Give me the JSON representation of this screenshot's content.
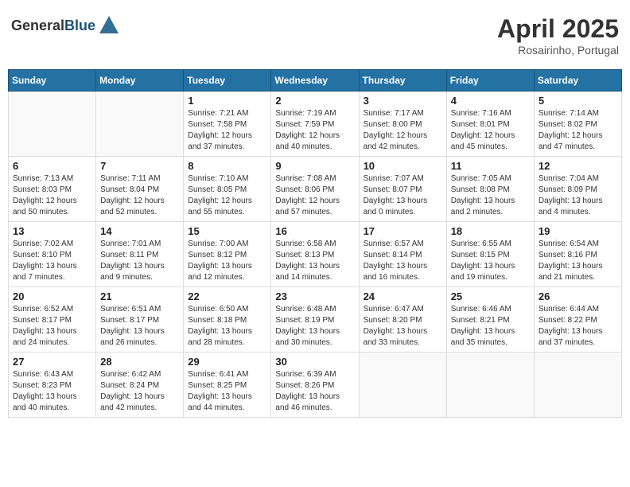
{
  "header": {
    "logo_general": "General",
    "logo_blue": "Blue",
    "month_title": "April 2025",
    "location": "Rosairinho, Portugal"
  },
  "weekdays": [
    "Sunday",
    "Monday",
    "Tuesday",
    "Wednesday",
    "Thursday",
    "Friday",
    "Saturday"
  ],
  "weeks": [
    [
      {
        "day": "",
        "info": ""
      },
      {
        "day": "",
        "info": ""
      },
      {
        "day": "1",
        "info": "Sunrise: 7:21 AM\nSunset: 7:58 PM\nDaylight: 12 hours and 37 minutes."
      },
      {
        "day": "2",
        "info": "Sunrise: 7:19 AM\nSunset: 7:59 PM\nDaylight: 12 hours and 40 minutes."
      },
      {
        "day": "3",
        "info": "Sunrise: 7:17 AM\nSunset: 8:00 PM\nDaylight: 12 hours and 42 minutes."
      },
      {
        "day": "4",
        "info": "Sunrise: 7:16 AM\nSunset: 8:01 PM\nDaylight: 12 hours and 45 minutes."
      },
      {
        "day": "5",
        "info": "Sunrise: 7:14 AM\nSunset: 8:02 PM\nDaylight: 12 hours and 47 minutes."
      }
    ],
    [
      {
        "day": "6",
        "info": "Sunrise: 7:13 AM\nSunset: 8:03 PM\nDaylight: 12 hours and 50 minutes."
      },
      {
        "day": "7",
        "info": "Sunrise: 7:11 AM\nSunset: 8:04 PM\nDaylight: 12 hours and 52 minutes."
      },
      {
        "day": "8",
        "info": "Sunrise: 7:10 AM\nSunset: 8:05 PM\nDaylight: 12 hours and 55 minutes."
      },
      {
        "day": "9",
        "info": "Sunrise: 7:08 AM\nSunset: 8:06 PM\nDaylight: 12 hours and 57 minutes."
      },
      {
        "day": "10",
        "info": "Sunrise: 7:07 AM\nSunset: 8:07 PM\nDaylight: 13 hours and 0 minutes."
      },
      {
        "day": "11",
        "info": "Sunrise: 7:05 AM\nSunset: 8:08 PM\nDaylight: 13 hours and 2 minutes."
      },
      {
        "day": "12",
        "info": "Sunrise: 7:04 AM\nSunset: 8:09 PM\nDaylight: 13 hours and 4 minutes."
      }
    ],
    [
      {
        "day": "13",
        "info": "Sunrise: 7:02 AM\nSunset: 8:10 PM\nDaylight: 13 hours and 7 minutes."
      },
      {
        "day": "14",
        "info": "Sunrise: 7:01 AM\nSunset: 8:11 PM\nDaylight: 13 hours and 9 minutes."
      },
      {
        "day": "15",
        "info": "Sunrise: 7:00 AM\nSunset: 8:12 PM\nDaylight: 13 hours and 12 minutes."
      },
      {
        "day": "16",
        "info": "Sunrise: 6:58 AM\nSunset: 8:13 PM\nDaylight: 13 hours and 14 minutes."
      },
      {
        "day": "17",
        "info": "Sunrise: 6:57 AM\nSunset: 8:14 PM\nDaylight: 13 hours and 16 minutes."
      },
      {
        "day": "18",
        "info": "Sunrise: 6:55 AM\nSunset: 8:15 PM\nDaylight: 13 hours and 19 minutes."
      },
      {
        "day": "19",
        "info": "Sunrise: 6:54 AM\nSunset: 8:16 PM\nDaylight: 13 hours and 21 minutes."
      }
    ],
    [
      {
        "day": "20",
        "info": "Sunrise: 6:52 AM\nSunset: 8:17 PM\nDaylight: 13 hours and 24 minutes."
      },
      {
        "day": "21",
        "info": "Sunrise: 6:51 AM\nSunset: 8:17 PM\nDaylight: 13 hours and 26 minutes."
      },
      {
        "day": "22",
        "info": "Sunrise: 6:50 AM\nSunset: 8:18 PM\nDaylight: 13 hours and 28 minutes."
      },
      {
        "day": "23",
        "info": "Sunrise: 6:48 AM\nSunset: 8:19 PM\nDaylight: 13 hours and 30 minutes."
      },
      {
        "day": "24",
        "info": "Sunrise: 6:47 AM\nSunset: 8:20 PM\nDaylight: 13 hours and 33 minutes."
      },
      {
        "day": "25",
        "info": "Sunrise: 6:46 AM\nSunset: 8:21 PM\nDaylight: 13 hours and 35 minutes."
      },
      {
        "day": "26",
        "info": "Sunrise: 6:44 AM\nSunset: 8:22 PM\nDaylight: 13 hours and 37 minutes."
      }
    ],
    [
      {
        "day": "27",
        "info": "Sunrise: 6:43 AM\nSunset: 8:23 PM\nDaylight: 13 hours and 40 minutes."
      },
      {
        "day": "28",
        "info": "Sunrise: 6:42 AM\nSunset: 8:24 PM\nDaylight: 13 hours and 42 minutes."
      },
      {
        "day": "29",
        "info": "Sunrise: 6:41 AM\nSunset: 8:25 PM\nDaylight: 13 hours and 44 minutes."
      },
      {
        "day": "30",
        "info": "Sunrise: 6:39 AM\nSunset: 8:26 PM\nDaylight: 13 hours and 46 minutes."
      },
      {
        "day": "",
        "info": ""
      },
      {
        "day": "",
        "info": ""
      },
      {
        "day": "",
        "info": ""
      }
    ]
  ]
}
